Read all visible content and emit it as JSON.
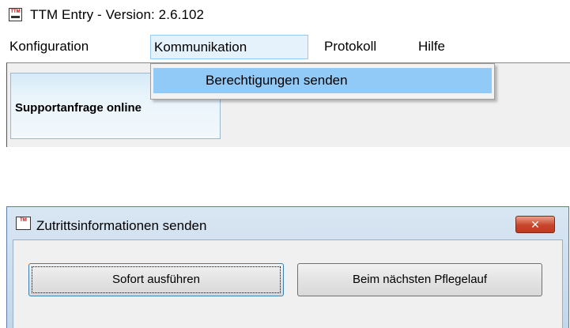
{
  "app": {
    "icon_text": "TTM",
    "title": "TTM Entry - Version: 2.6.102"
  },
  "menubar": {
    "items": [
      {
        "label": "Konfiguration"
      },
      {
        "label": "Kommunikation"
      },
      {
        "label": "Protokoll"
      },
      {
        "label": "Hilfe"
      }
    ]
  },
  "dropdown": {
    "items": [
      {
        "label": "Berechtigungen senden"
      }
    ]
  },
  "tab": {
    "label": "Supportanfrage online"
  },
  "dialog": {
    "icon_text": "TM",
    "title": "Zutrittsinformationen senden",
    "close_glyph": "✕",
    "buttons": {
      "now": "Sofort ausführen",
      "next_maintenance": "Beim nächsten Pflegelauf"
    }
  },
  "colors": {
    "menu_highlight": "#91c9f7",
    "close_button": "#c7452a"
  }
}
